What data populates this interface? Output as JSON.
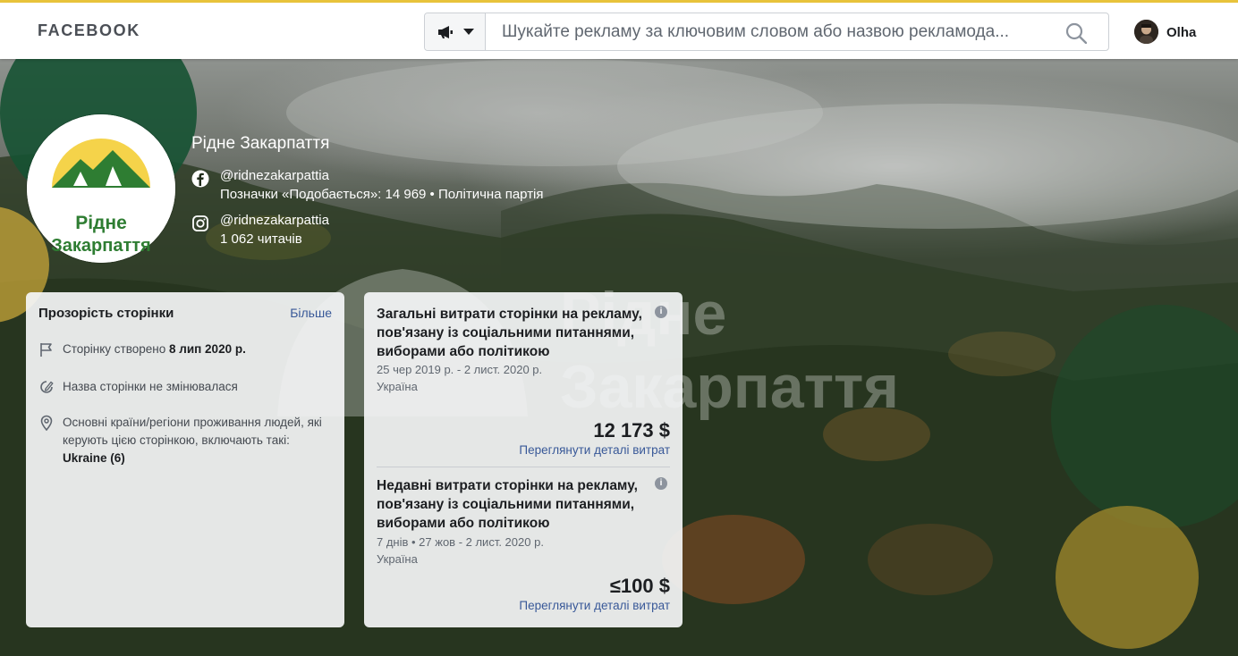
{
  "header": {
    "brand": "FACEBOOK",
    "search": {
      "placeholder": "Шукайте рекламу за ключовим словом або назвою рекламода..."
    },
    "user": {
      "name": "Olha"
    }
  },
  "page": {
    "name": "Рідне Закарпаття",
    "logo_text": {
      "line1": "Рідне",
      "line2": "Закарпаття"
    },
    "facebook": {
      "handle": "@ridnezakarpattia",
      "details": "Позначки «Подобається»: 14 969 • Політична партія"
    },
    "instagram": {
      "handle": "@ridnezakarpattia",
      "details": "1 062 читачів"
    },
    "cover_watermark": {
      "line1": "Рідне",
      "line2": "Закарпаття"
    }
  },
  "transparency": {
    "title": "Прозорість сторінки",
    "more_label": "Більше",
    "created": {
      "prefix": "Сторінку створено ",
      "date": "8 лип 2020 р."
    },
    "name_change": "Назва сторінки не змінювалася",
    "countries": {
      "text": "Основні країни/регіони проживання людей, які керують цією сторінкою, включають такі: ",
      "value": "Ukraine (6)"
    }
  },
  "spending": {
    "total": {
      "title": "Загальні витрати сторінки на рекламу, пов'язану із соціальними питаннями, виборами або політикою",
      "period": "25 чер 2019 р. - 2 лист. 2020 р.",
      "region": "Україна",
      "amount": "12 173 $",
      "link": "Переглянути деталі витрат"
    },
    "recent": {
      "title": "Недавні витрати сторінки на рекламу, пов'язану із соціальними питаннями, виборами або політикою",
      "period": "7 днів • 27 жов - 2 лист. 2020 р.",
      "region": "Україна",
      "amount": "≤100 $",
      "link": "Переглянути деталі витрат"
    },
    "info_icon": "i"
  },
  "colors": {
    "brand_green": "#2e7d32",
    "brand_yellow": "#f5d34a",
    "link_blue": "#385898",
    "top_border_yellow": "#e8c33b"
  }
}
